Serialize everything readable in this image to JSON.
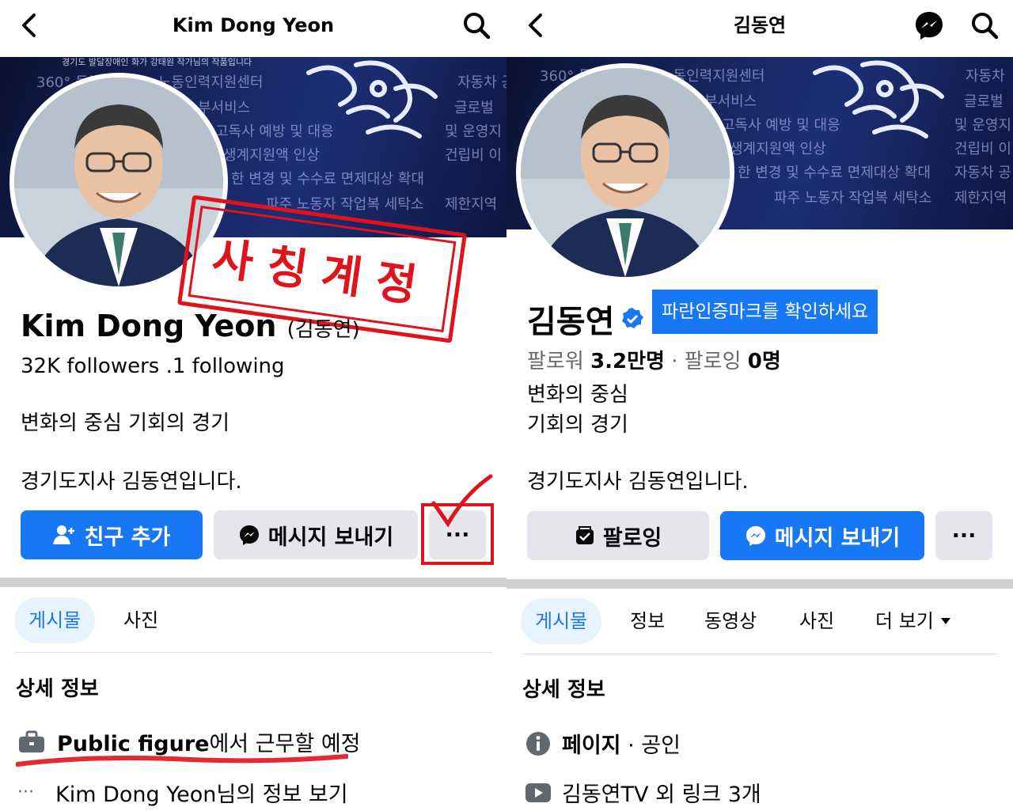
{
  "left": {
    "header_title": "Kim Dong Yeon",
    "cover_lines": [
      "360° 돌봄",
      "노동인력지원센터",
      "부서비스",
      "고독사 예방 및 대응",
      "생계지원액 인상",
      "한 변경 및 수수료 면제대상 확대",
      "파주 노동자 작업복 세탁소",
      "자동차 공",
      "글로벌",
      "및 운영지",
      "건립비 이",
      "제한지역"
    ],
    "cover_caption": "경기도 발달장애인 화가 강태원 작가님의 작품입니다",
    "stamp_text": "사칭계정",
    "name": "Kim Dong Yeon",
    "name_korean": "(김동연)",
    "stats": "32K followers .1 following",
    "bio1": "변화의 중심 기회의 경기",
    "bio2": "경기도지사 김동연입니다.",
    "btn_add_friend": "친구 추가",
    "btn_message": "메시지 보내기",
    "btn_more": "···",
    "tabs": [
      "게시물",
      "사진"
    ],
    "details_title": "상세 정보",
    "work_bold": "Public figure",
    "work_rest": "에서 근무할 예정",
    "info_link": "Kim Dong Yeon님의 정보 보기"
  },
  "right": {
    "header_title": "김동연",
    "cover_lines": [
      "360° 돌",
      "노동인력지원센터",
      "부서비스",
      "고독사 예방 및 대응",
      "생계지원액 인상",
      "한 변경 및 수수료 면제대상 확대",
      "파주 노동자 작업복 세탁소",
      "자동차",
      "글로벌",
      "및 운영지",
      "건립비 이",
      "자동차 공",
      "제한지역"
    ],
    "name": "김동연",
    "verify_label": "파란인증마크를 확인하세요",
    "followers_label": "팔로워",
    "followers_value": "3.2만명",
    "following_label": "팔로잉",
    "following_value": "0명",
    "bio1": "변화의 중심",
    "bio2": "기회의 경기",
    "bio3": "경기도지사 김동연입니다.",
    "btn_following": "팔로잉",
    "btn_message": "메시지 보내기",
    "btn_more": "···",
    "tabs": [
      "게시물",
      "정보",
      "동영상",
      "사진",
      "더 보기"
    ],
    "details_title": "상세 정보",
    "page_bold": "페이지",
    "page_rest": " · 공인",
    "links": "김동연TV 외 링크 3개"
  },
  "colors": {
    "facebook_blue": "#1877f2",
    "stamp_red": "#e0121b",
    "button_gray": "#e4e6eb"
  },
  "icons": [
    "back-arrow-icon",
    "search-icon",
    "messenger-icon",
    "add-friend-icon",
    "following-icon",
    "verified-badge-icon",
    "briefcase-icon",
    "info-icon",
    "youtube-icon",
    "more-dots-icon",
    "dropdown-caret-icon",
    "checkmark-icon"
  ]
}
